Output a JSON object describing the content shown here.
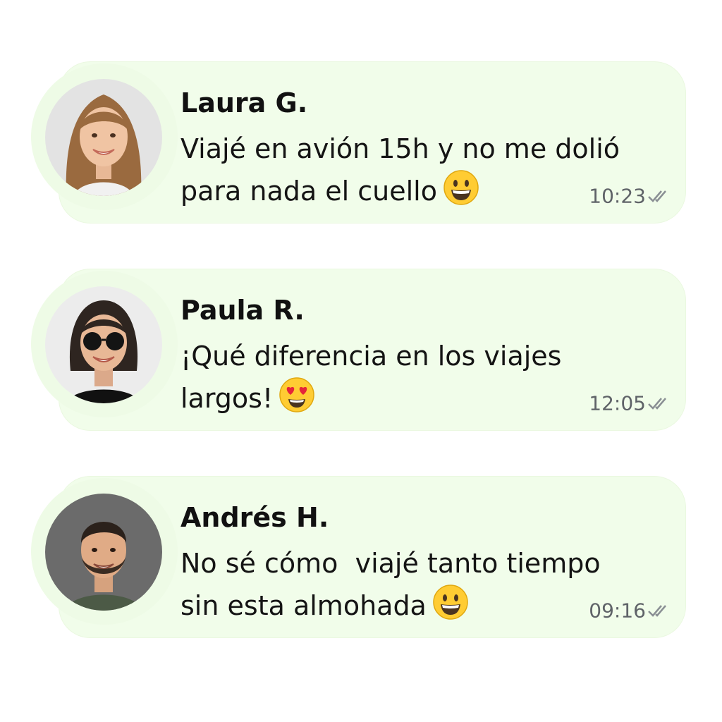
{
  "messages": [
    {
      "name": "Laura G.",
      "line1": "Viajé en avión 15h y no me dolió",
      "line2": "para nada el cuello",
      "emoji": "grinning-face",
      "time": "10:23",
      "status": "read-double-check"
    },
    {
      "name": "Paula R.",
      "line1": "¡Qué diferencia en los viajes",
      "line2": "largos!",
      "emoji": "heart-eyes-face",
      "time": "12:05",
      "status": "read-double-check"
    },
    {
      "name": "Andrés H.",
      "line1": "No sé cómo  viajé tanto tiempo",
      "line2": "sin esta almohada",
      "emoji": "grinning-face",
      "time": "09:16",
      "status": "read-double-check"
    }
  ],
  "colors": {
    "bubble": "#f1fdea",
    "name_text": "#111111",
    "meta_text": "#5f6368",
    "emoji_yellow": "#ffcc33"
  }
}
